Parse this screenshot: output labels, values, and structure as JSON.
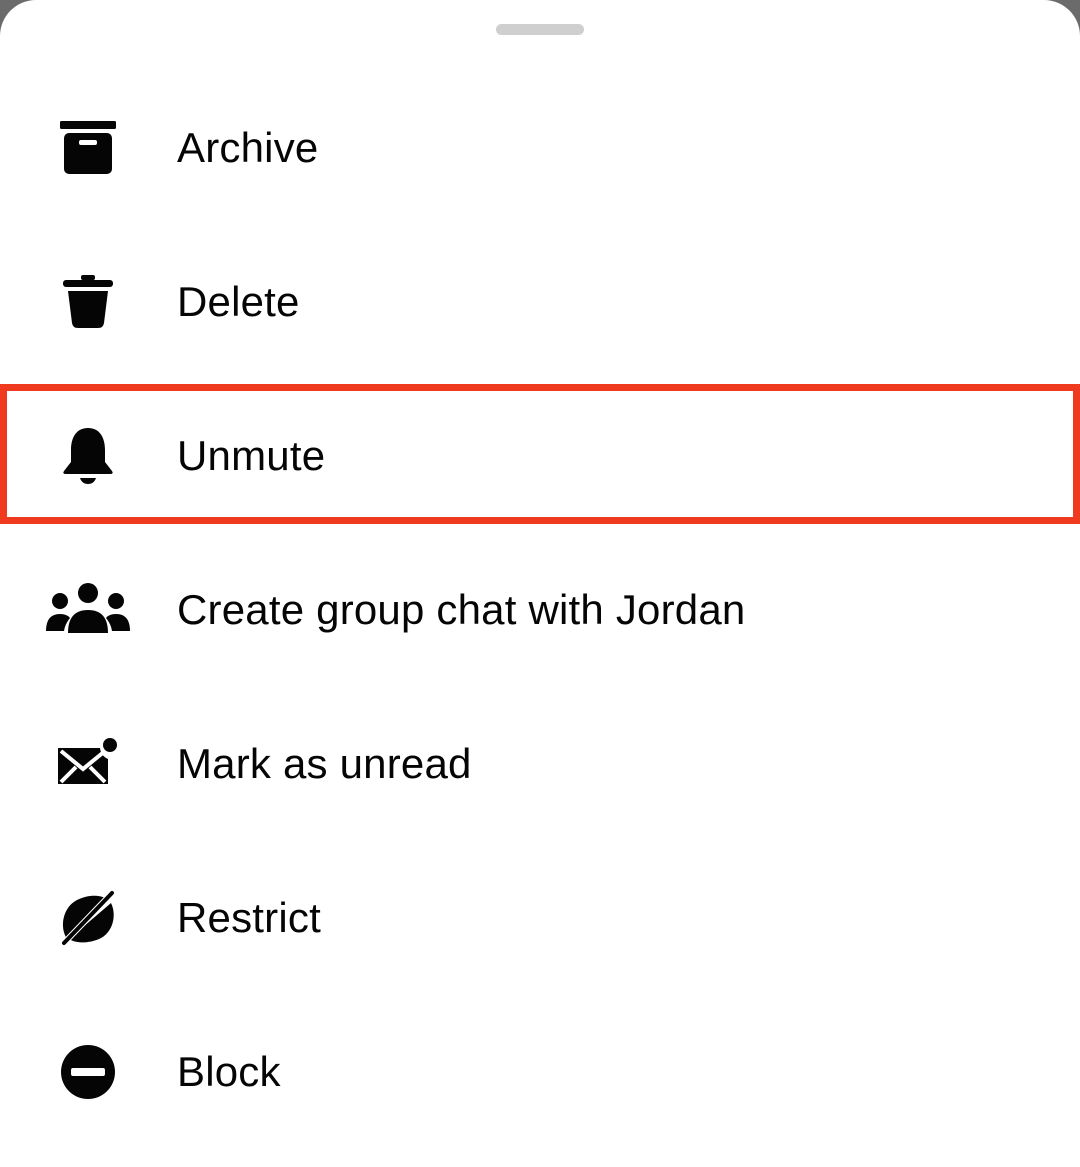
{
  "sheet": {
    "items": [
      {
        "label": "Archive",
        "icon": "archive-icon"
      },
      {
        "label": "Delete",
        "icon": "trash-icon"
      },
      {
        "label": "Unmute",
        "icon": "bell-icon"
      },
      {
        "label": "Create group chat with Jordan",
        "icon": "group-icon"
      },
      {
        "label": "Mark as unread",
        "icon": "envelope-unread-icon"
      },
      {
        "label": "Restrict",
        "icon": "restrict-icon"
      },
      {
        "label": "Block",
        "icon": "block-icon"
      }
    ],
    "highlighted_item": "Unmute"
  },
  "colors": {
    "highlight_border": "#f03a1f",
    "text": "#050505",
    "background": "#ffffff",
    "handle": "#cfcfcf"
  }
}
